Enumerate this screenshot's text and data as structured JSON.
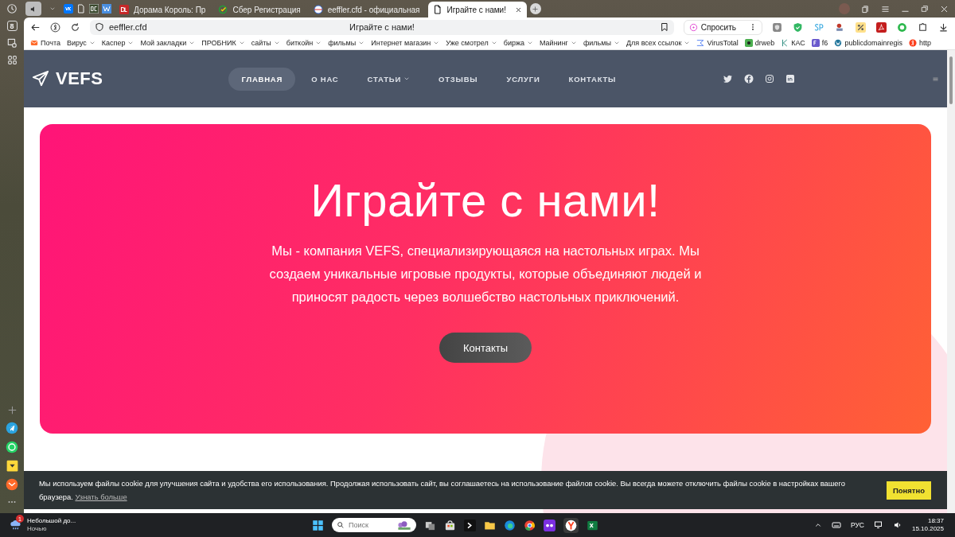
{
  "sidebar": {
    "tab_count": "8"
  },
  "tabs": [
    {
      "title": "Дорама Король: Пр",
      "selected": false,
      "kind": "dl"
    },
    {
      "title": "Сбер Регистрация",
      "selected": false,
      "kind": "sber"
    },
    {
      "title": "eeffler.cfd - официальная",
      "selected": false,
      "kind": "site"
    },
    {
      "title": "Играйте с нами!",
      "selected": true,
      "kind": "doc"
    }
  ],
  "toolbar": {
    "address": "eeffler.cfd",
    "page_title": "Играйте с нами!",
    "ask_button": "Спросить"
  },
  "bookmarks": [
    {
      "label": "Почта",
      "kind": "mail"
    },
    {
      "label": "Вирус",
      "kind": "folder"
    },
    {
      "label": "Каспер",
      "kind": "folder"
    },
    {
      "label": "Мой закладки",
      "kind": "folder"
    },
    {
      "label": "ПРОБНИК",
      "kind": "folder"
    },
    {
      "label": "сайты",
      "kind": "folder"
    },
    {
      "label": "биткойн",
      "kind": "folder"
    },
    {
      "label": "фильмы",
      "kind": "folder"
    },
    {
      "label": "Интернет магазин",
      "kind": "folder"
    },
    {
      "label": "Уже смотрел",
      "kind": "folder"
    },
    {
      "label": "биржа",
      "kind": "folder"
    },
    {
      "label": "Майнинг",
      "kind": "folder"
    },
    {
      "label": "фильмы",
      "kind": "folder"
    },
    {
      "label": "Для всех ссылок",
      "kind": "folder"
    },
    {
      "label": "VirusTotal",
      "kind": "virustotal"
    },
    {
      "label": "drweb",
      "kind": "drweb"
    },
    {
      "label": "КАС",
      "kind": "kas"
    },
    {
      "label": "f6",
      "kind": "f6"
    },
    {
      "label": "publicdomainregis",
      "kind": "wp"
    },
    {
      "label": "http",
      "kind": "ya"
    }
  ],
  "site": {
    "logo": "VEFS",
    "nav": [
      {
        "label": "ГЛАВНАЯ",
        "selected": true,
        "dropdown": false
      },
      {
        "label": "О НАС",
        "selected": false,
        "dropdown": false
      },
      {
        "label": "СТАТЬИ",
        "selected": false,
        "dropdown": true
      },
      {
        "label": "ОТЗЫВЫ",
        "selected": false,
        "dropdown": false
      },
      {
        "label": "УСЛУГИ",
        "selected": false,
        "dropdown": false
      },
      {
        "label": "КОНТАКТЫ",
        "selected": false,
        "dropdown": false
      }
    ],
    "hero": {
      "title": "Играйте с нами!",
      "text": "Мы - компания VEFS, специализирующаяся на настольных играх. Мы создаем уникальные игровые продукты, которые объединяют людей и приносят радость через волшебство настольных приключений.",
      "button": "Контакты"
    }
  },
  "cookie": {
    "text": "Мы используем файлы cookie для улучшения сайта и удобства его использования. Продолжая использовать сайт, вы соглашаетесь на использование файлов cookie. Вы всегда можете отключить файлы cookie в настройках вашего браузера.",
    "link": "Узнать больше",
    "button": "Понятно"
  },
  "taskbar": {
    "weather_badge": "1",
    "weather": "Небольшой до...",
    "weather_sub": "Ночью",
    "search_placeholder": "Поиск",
    "language": "РУС",
    "time": "18:37",
    "date": "15.10.2025"
  }
}
